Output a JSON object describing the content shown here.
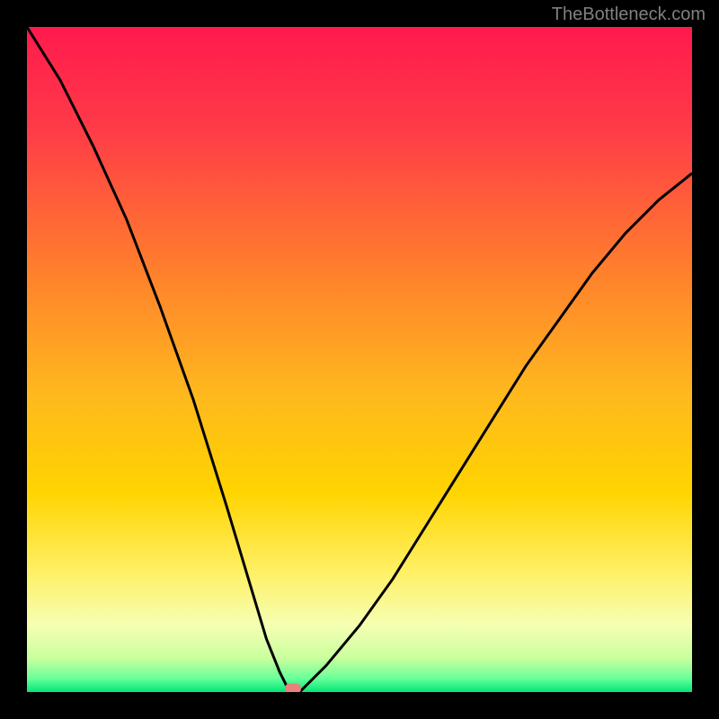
{
  "watermark": "TheBottleneck.com",
  "chart_data": {
    "type": "line",
    "title": "",
    "xlabel": "",
    "ylabel": "",
    "x_range": [
      0,
      100
    ],
    "y_range": [
      0,
      100
    ],
    "minimum_point": {
      "x": 40,
      "y": 0
    },
    "series": [
      {
        "name": "curve",
        "description": "V-shaped absolute-value-like curve with minimum near x=40",
        "x": [
          0,
          5,
          10,
          15,
          20,
          25,
          30,
          33,
          36,
          38,
          39,
          40,
          41,
          42,
          45,
          50,
          55,
          60,
          65,
          70,
          75,
          80,
          85,
          90,
          95,
          100
        ],
        "y": [
          100,
          92,
          82,
          71,
          58,
          44,
          28,
          18,
          8,
          3,
          1,
          0,
          0,
          1,
          4,
          10,
          17,
          25,
          33,
          41,
          49,
          56,
          63,
          69,
          74,
          78
        ]
      }
    ],
    "gradient_colors": {
      "top": "#ff1a4d",
      "upper_mid": "#ff7a2e",
      "mid": "#ffd400",
      "lower_mid": "#fff066",
      "lower": "#e8ffb3",
      "bottom": "#00e676"
    },
    "marker": {
      "x": 40,
      "y": 0,
      "color": "#e88080"
    }
  }
}
